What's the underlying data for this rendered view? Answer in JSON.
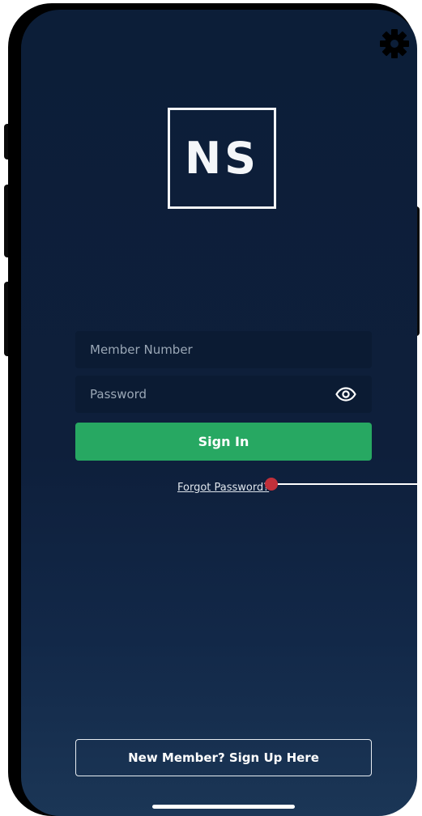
{
  "logo": {
    "text": "NS"
  },
  "settings": {
    "icon": "gear-icon"
  },
  "login": {
    "member_number_placeholder": "Member Number",
    "password_placeholder": "Password",
    "show_password_icon": "eye-icon",
    "sign_in_label": "Sign In",
    "forgot_password_label": "Forgot Password?"
  },
  "signup": {
    "label": "New Member? Sign Up Here"
  },
  "colors": {
    "background": "#0e1f3b",
    "sign_in_button": "#27a862",
    "annotation_dot": "#c0303a"
  }
}
